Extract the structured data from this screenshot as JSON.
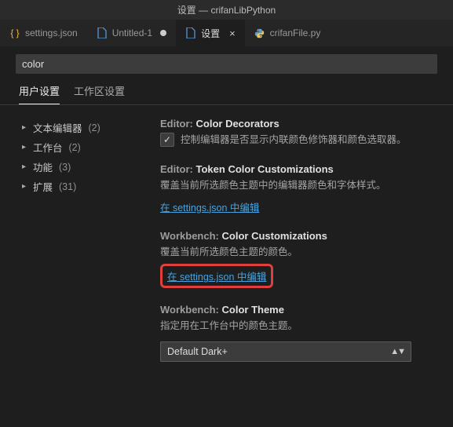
{
  "titlebar": "设置 — crifanLibPython",
  "tabs": [
    {
      "label": "settings.json",
      "iconName": "json-icon"
    },
    {
      "label": "Untitled-1",
      "iconName": "file-icon",
      "dirty": true
    },
    {
      "label": "设置",
      "iconName": "file-icon",
      "active": true
    },
    {
      "label": "crifanFile.py",
      "iconName": "python-icon"
    }
  ],
  "search": {
    "value": "color"
  },
  "scope": {
    "user": "用户设置",
    "workspace": "工作区设置"
  },
  "tree": [
    {
      "label": "文本编辑器",
      "count": "(2)"
    },
    {
      "label": "工作台",
      "count": "(2)"
    },
    {
      "label": "功能",
      "count": "(3)"
    },
    {
      "label": "扩展",
      "count": "(31)"
    }
  ],
  "settings": {
    "colorDecorators": {
      "cat": "Editor:",
      "name": "Color Decorators",
      "desc": "控制编辑器是否显示内联颜色修饰器和颜色选取器。"
    },
    "tokenColor": {
      "cat": "Editor:",
      "name": "Token Color Customizations",
      "desc": "覆盖当前所选颜色主题中的编辑器颜色和字体样式。",
      "link": "在 settings.json 中编辑"
    },
    "wbColorCustom": {
      "cat": "Workbench:",
      "name": "Color Customizations",
      "desc": "覆盖当前所选颜色主题的颜色。",
      "link": "在 settings.json 中编辑"
    },
    "wbColorTheme": {
      "cat": "Workbench:",
      "name": "Color Theme",
      "desc": "指定用在工作台中的颜色主题。",
      "value": "Default Dark+"
    }
  }
}
